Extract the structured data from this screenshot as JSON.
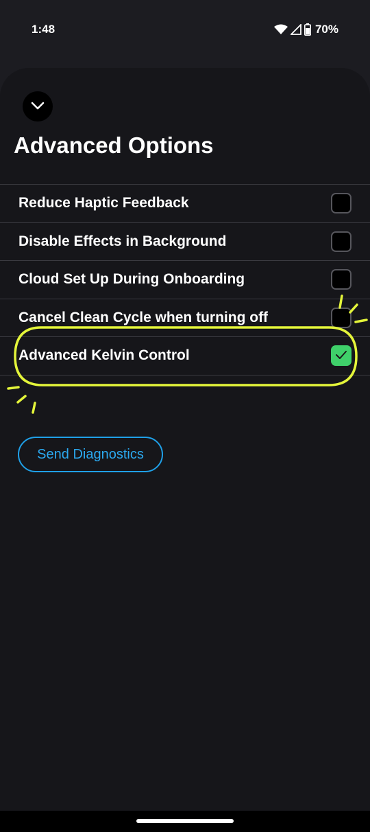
{
  "status_bar": {
    "time": "1:48",
    "battery": "70%",
    "icons": [
      "wifi-icon",
      "signal-icon",
      "battery-icon"
    ]
  },
  "sheet": {
    "collapse_icon": "chevron-down-icon",
    "title": "Advanced Options",
    "options": [
      {
        "label": "Reduce Haptic Feedback",
        "checked": false
      },
      {
        "label": "Disable Effects in Background",
        "checked": false
      },
      {
        "label": "Cloud Set Up During Onboarding",
        "checked": false
      },
      {
        "label": "Cancel Clean Cycle when turning off",
        "checked": false
      },
      {
        "label": "Advanced Kelvin Control",
        "checked": true
      }
    ],
    "diagnostics_button": "Send Diagnostics"
  },
  "colors": {
    "background": "#1c1c21",
    "sheet": "#16161a",
    "checked": "#3fd06a",
    "accent": "#1fa0e8",
    "highlight": "#e4f53a"
  }
}
